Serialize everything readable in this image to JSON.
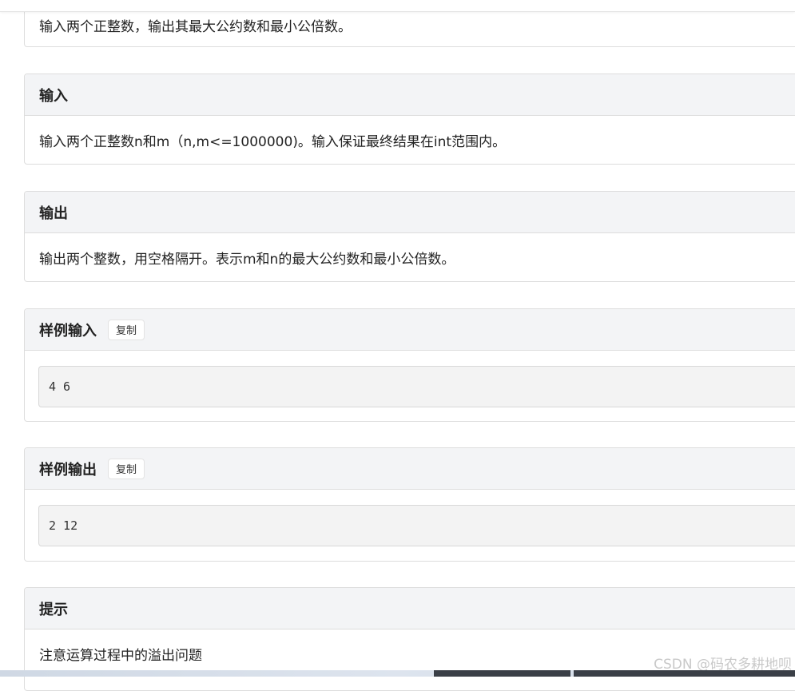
{
  "description": {
    "text": "输入两个正整数，输出其最大公约数和最小公倍数。"
  },
  "input_section": {
    "title": "输入",
    "text": "输入两个正整数n和m（n,m<=1000000)。输入保证最终结果在int范围内。"
  },
  "output_section": {
    "title": "输出",
    "text": "输出两个整数，用空格隔开。表示m和n的最大公约数和最小公倍数。"
  },
  "sample_input": {
    "title": "样例输入",
    "copy_label": "复制",
    "code": "4 6"
  },
  "sample_output": {
    "title": "样例输出",
    "copy_label": "复制",
    "code": "2 12"
  },
  "hint_section": {
    "title": "提示",
    "text": "注意运算过程中的溢出问题"
  },
  "watermark": "CSDN @码农多耕地呗"
}
